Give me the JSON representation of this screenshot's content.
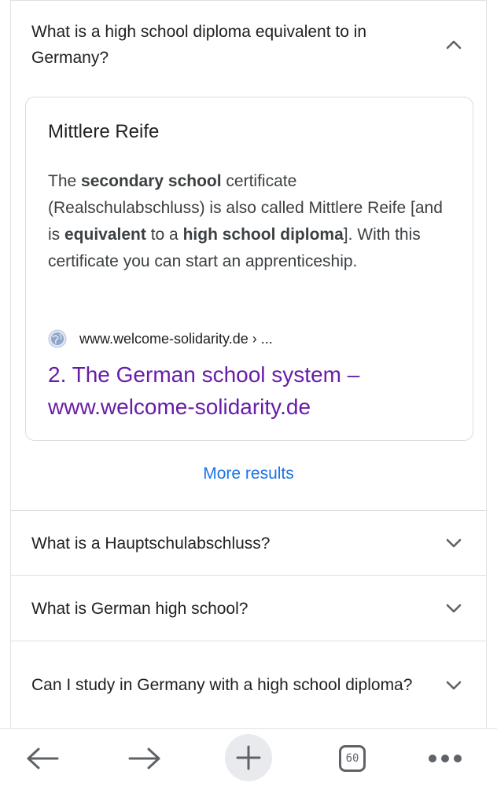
{
  "faq": {
    "expanded_question": "What is a high school diploma equivalent to in Germany?",
    "answer": {
      "title": "Mittlere Reife",
      "snippet_parts": [
        {
          "text": "The ",
          "bold": false
        },
        {
          "text": "secondary school",
          "bold": true
        },
        {
          "text": " certificate (Realschulabschluss) is also called Mittlere Reife [and is ",
          "bold": false
        },
        {
          "text": "equivalent",
          "bold": true
        },
        {
          "text": " to a ",
          "bold": false
        },
        {
          "text": "high school diploma",
          "bold": true
        },
        {
          "text": "]. With this certificate you can start an apprenticeship.",
          "bold": false
        }
      ],
      "source_url": "www.welcome-solidarity.de › ...",
      "result_title": "2. The German school system – www.welcome-solidarity.de"
    },
    "more_results_label": "More results",
    "collapsed_questions": [
      "What is a Hauptschulabschluss?",
      "What is German high school?",
      "Can I study in Germany with a high school diploma?"
    ]
  },
  "bottom_nav": {
    "back_icon": "arrow-left-icon",
    "forward_icon": "arrow-right-icon",
    "new_tab_icon": "plus-icon",
    "tab_count": "60",
    "menu_icon": "more-dots-icon"
  },
  "colors": {
    "link_visited": "#681da8",
    "more_results": "#1a73e8",
    "divider": "#e0e0e0"
  }
}
